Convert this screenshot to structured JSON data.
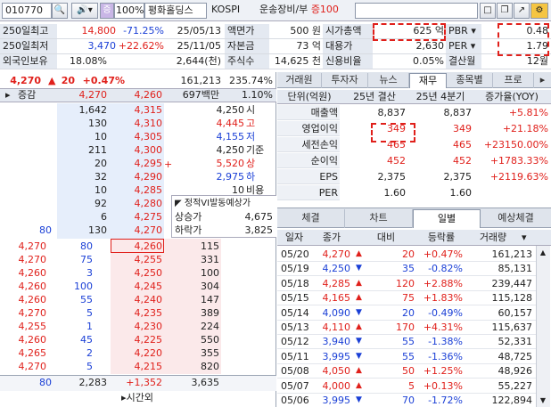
{
  "top": {
    "code": "010770",
    "pct_badge": "증",
    "pct": "100%",
    "name": "평화홀딩스",
    "market": "KOSPI",
    "sector": "운송장비/부",
    "margin": "증100"
  },
  "info": {
    "r1": {
      "l1": "250일최고",
      "v1": "14,800",
      "p1": "-71.25%",
      "d1": "25/05/13",
      "l2": "액면가",
      "v2": "500 원",
      "l3": "시가총액",
      "v3": "625 억",
      "l4": "PBR",
      "v4": "0.48"
    },
    "r2": {
      "l1": "250일최저",
      "v1": "3,470",
      "p1": "+22.62%",
      "d1": "25/11/05",
      "l2": "자본금",
      "v2": "73 억",
      "l3": "대용가",
      "v3": "2,630",
      "l4": "PER",
      "v4": "1.79"
    },
    "r3": {
      "l1": "외국인보유",
      "v1": "18.08%",
      "v1b": "2,644(천)",
      "l2": "주식수",
      "v2": "14,625 천",
      "l3": "신용비율",
      "v3": "0.05%",
      "l4": "결산월",
      "v4": "12월"
    }
  },
  "price": {
    "price": "4,270",
    "arrow": "▲",
    "change": "20",
    "pct": "+0.47%",
    "volume": "161,213",
    "turnover": "235.74%"
  },
  "orderbook": {
    "hdr": {
      "label": "증감",
      "ask_total": "4,270",
      "bid_total": "4,260",
      "amount": "697백만",
      "rate": "1.10%"
    },
    "asks": [
      {
        "qty": "1,642",
        "price": "4,315"
      },
      {
        "qty": "130",
        "price": "4,310"
      },
      {
        "qty": "10",
        "price": "4,305"
      },
      {
        "qty": "211",
        "price": "4,300"
      },
      {
        "qty": "20",
        "price": "4,295"
      },
      {
        "qty": "32",
        "price": "4,290"
      },
      {
        "qty": "10",
        "price": "4,285"
      },
      {
        "qty": "92",
        "price": "4,280"
      },
      {
        "qty": "6",
        "price": "4,275"
      },
      {
        "qty": "130",
        "price": "4,270",
        "chg": "80"
      }
    ],
    "bids": [
      {
        "price": "4,260",
        "qty": "115"
      },
      {
        "price": "4,255",
        "qty": "331"
      },
      {
        "price": "4,250",
        "qty": "100"
      },
      {
        "price": "4,245",
        "qty": "304"
      },
      {
        "price": "4,240",
        "qty": "147"
      },
      {
        "price": "4,235",
        "qty": "389"
      },
      {
        "price": "4,230",
        "qty": "224"
      },
      {
        "price": "4,225",
        "qty": "550"
      },
      {
        "price": "4,220",
        "qty": "355"
      },
      {
        "price": "4,215",
        "qty": "820"
      }
    ],
    "summary": [
      {
        "k": "4,250",
        "v": "시"
      },
      {
        "k": "4,445",
        "v": "고"
      },
      {
        "k": "4,155",
        "v": "저"
      },
      {
        "k": "4,250",
        "v": "기준"
      },
      {
        "k": "5,520",
        "v": "상"
      },
      {
        "k": "2,975",
        "v": "하"
      },
      {
        "k": "10",
        "v": "비용"
      }
    ],
    "vi": {
      "title": "정적VI발동예상가",
      "up_label": "상승가",
      "up": "4,675",
      "down_label": "하락가",
      "down": "3,825"
    },
    "ticks": [
      {
        "p": "4,270",
        "q": "80"
      },
      {
        "p": "4,270",
        "q": "75"
      },
      {
        "p": "4,260",
        "q": "3"
      },
      {
        "p": "4,260",
        "q": "100"
      },
      {
        "p": "4,260",
        "q": "55"
      },
      {
        "p": "4,270",
        "q": "5"
      },
      {
        "p": "4,255",
        "q": "1"
      },
      {
        "p": "4,260",
        "q": "45"
      },
      {
        "p": "4,265",
        "q": "2"
      },
      {
        "p": "4,270",
        "q": "5"
      }
    ],
    "footer": {
      "chg": "80",
      "ask_sum": "2,283",
      "diff": "+1,352",
      "bid_sum": "3,635",
      "after": "시간외"
    }
  },
  "fin": {
    "tabs": [
      "거래원",
      "투자자",
      "뉴스",
      "재무",
      "종목별",
      "프로"
    ],
    "cols": [
      "단위(억원)",
      "25년 결산",
      "25년 4분기",
      "증가율(YOY)"
    ],
    "rows": [
      {
        "k": "매출액",
        "a": "8,837",
        "b": "8,837",
        "c": "+5.81%"
      },
      {
        "k": "영업이익",
        "a": "349",
        "b": "349",
        "c": "+21.18%"
      },
      {
        "k": "세전손익",
        "a": "465",
        "b": "465",
        "c": "+23150.00%"
      },
      {
        "k": "순이익",
        "a": "452",
        "b": "452",
        "c": "+1783.33%"
      },
      {
        "k": "EPS",
        "a": "2,375",
        "b": "2,375",
        "c": "+2119.63%"
      },
      {
        "k": "PER",
        "a": "1.60",
        "b": "1.60",
        "c": ""
      }
    ]
  },
  "daily": {
    "tabs": [
      "체결",
      "차트",
      "일별",
      "예상체결"
    ],
    "cols": [
      "일자",
      "종가",
      "대비",
      "등락률",
      "거래량"
    ],
    "rows": [
      {
        "d": "05/20",
        "p": "4,270",
        "a": "▲",
        "c": "20",
        "r": "+0.47%",
        "v": "161,213",
        "dir": "up"
      },
      {
        "d": "05/19",
        "p": "4,250",
        "a": "▼",
        "c": "35",
        "r": "-0.82%",
        "v": "85,131",
        "dir": "down"
      },
      {
        "d": "05/18",
        "p": "4,285",
        "a": "▲",
        "c": "120",
        "r": "+2.88%",
        "v": "239,447",
        "dir": "up"
      },
      {
        "d": "05/15",
        "p": "4,165",
        "a": "▲",
        "c": "75",
        "r": "+1.83%",
        "v": "115,128",
        "dir": "up"
      },
      {
        "d": "05/14",
        "p": "4,090",
        "a": "▼",
        "c": "20",
        "r": "-0.49%",
        "v": "60,157",
        "dir": "down"
      },
      {
        "d": "05/13",
        "p": "4,110",
        "a": "▲",
        "c": "170",
        "r": "+4.31%",
        "v": "115,637",
        "dir": "up"
      },
      {
        "d": "05/12",
        "p": "3,940",
        "a": "▼",
        "c": "55",
        "r": "-1.38%",
        "v": "52,331",
        "dir": "down"
      },
      {
        "d": "05/11",
        "p": "3,995",
        "a": "▼",
        "c": "55",
        "r": "-1.36%",
        "v": "48,725",
        "dir": "down"
      },
      {
        "d": "05/08",
        "p": "4,050",
        "a": "▲",
        "c": "50",
        "r": "+1.25%",
        "v": "48,926",
        "dir": "up"
      },
      {
        "d": "05/07",
        "p": "4,000",
        "a": "▲",
        "c": "5",
        "r": "+0.13%",
        "v": "55,227",
        "dir": "up"
      },
      {
        "d": "05/06",
        "p": "3,995",
        "a": "▼",
        "c": "70",
        "r": "-1.72%",
        "v": "122,894",
        "dir": "down"
      }
    ]
  },
  "colors": {
    "up": "#e0201b",
    "down": "#1a3fd6",
    "ask_bg": "#e6eefb",
    "bid_bg": "#fbe9ea",
    "highlight": "#e0201b"
  }
}
